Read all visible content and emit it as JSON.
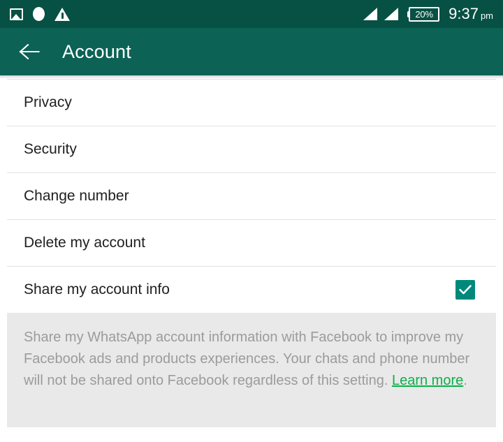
{
  "status_bar": {
    "background": "#075044",
    "left_icons": [
      {
        "name": "photo-icon",
        "label": "screenshot"
      },
      {
        "name": "circle-icon",
        "label": "recording"
      },
      {
        "name": "warning-icon",
        "label": "warning"
      }
    ],
    "signal_icons": [
      {
        "name": "signal-sim1-icon",
        "label": "signal"
      },
      {
        "name": "signal-sim2-icon",
        "label": "signal"
      }
    ],
    "battery": {
      "level_label": "20%"
    },
    "time": "9:37",
    "ampm": "pm"
  },
  "toolbar": {
    "back_label": "Back",
    "title": "Account",
    "background": "#0b6255",
    "text_color": "#ffffff"
  },
  "settings": {
    "rows": [
      {
        "label": "Privacy",
        "has_checkbox": false
      },
      {
        "label": "Security",
        "has_checkbox": false
      },
      {
        "label": "Change number",
        "has_checkbox": false
      },
      {
        "label": "Delete my account",
        "has_checkbox": false
      },
      {
        "label": "Share my account info",
        "has_checkbox": true,
        "checked": true
      }
    ]
  },
  "footer": {
    "text": "Share my WhatsApp account information with Facebook to improve my Facebook ads and products experiences. Your chats and phone number will not be shared onto Facebook regardless of this setting. ",
    "link_label": "Learn more",
    "link_suffix": ".",
    "background": "#e9e9e9",
    "text_color": "#9b9b9b",
    "link_color": "#0cb04a"
  },
  "accent": {
    "checkbox_color": "#00897b",
    "link_green": "#0cb04a"
  }
}
